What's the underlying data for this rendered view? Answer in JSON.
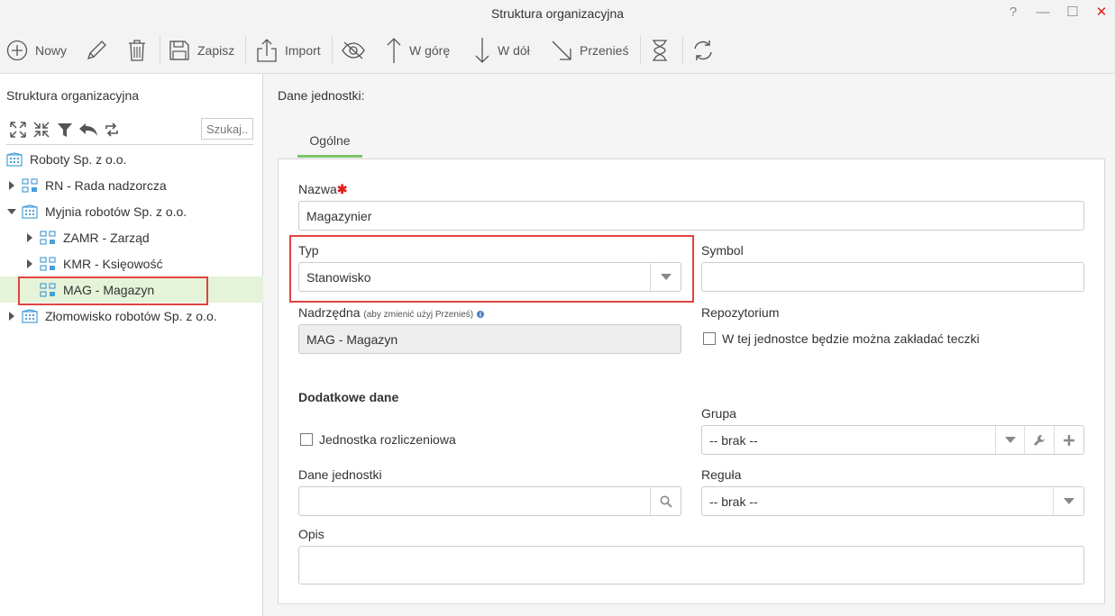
{
  "window": {
    "title": "Struktura organizacyjna",
    "help_glyph": "?",
    "min_glyph": "—",
    "max_glyph": "☐",
    "close_glyph": "✕"
  },
  "toolbar": {
    "new_label": "Nowy",
    "save_label": "Zapisz",
    "import_label": "Import",
    "up_label": "W górę",
    "down_label": "W dół",
    "move_label": "Przenieś"
  },
  "left_panel": {
    "title": "Struktura organizacyjna",
    "search_placeholder": "Szukaj...",
    "tree": [
      {
        "label": "Roboty Sp. z o.o.",
        "type": "company",
        "level": 0,
        "arrow": "none"
      },
      {
        "label": "RN - Rada nadzorcza",
        "type": "unit",
        "level": 0,
        "arrow": "collapsed"
      },
      {
        "label": "Myjnia robotów Sp. z o.o.",
        "type": "company",
        "level": 0,
        "arrow": "expanded"
      },
      {
        "label": "ZAMR - Zarząd",
        "type": "unit",
        "level": 1,
        "arrow": "collapsed"
      },
      {
        "label": "KMR - Księowość",
        "type": "unit",
        "level": 1,
        "arrow": "collapsed"
      },
      {
        "label": "MAG - Magazyn",
        "type": "unit",
        "level": 1,
        "arrow": "none",
        "selected": true
      },
      {
        "label": "Złomowisko robotów Sp. z o.o.",
        "type": "company",
        "level": 0,
        "arrow": "collapsed"
      }
    ]
  },
  "right_panel": {
    "section_title": "Dane jednostki:",
    "tab_general": "Ogólne",
    "name_label": "Nazwa",
    "required_mark": "✱",
    "name_value": "Magazynier",
    "type_label": "Typ",
    "type_value": "Stanowisko",
    "symbol_label": "Symbol",
    "symbol_value": "",
    "parent_label": "Nadrzędna",
    "parent_hint": "(aby zmienić użyj Przenieś)",
    "parent_value": "MAG - Magazyn",
    "repo_label": "Repozytorium",
    "repo_checkbox": "W tej jednostce będzie można zakładać teczki",
    "extra_title": "Dodatkowe dane",
    "billing_checkbox": "Jednostka rozliczeniowa",
    "group_label": "Grupa",
    "group_value": "-- brak --",
    "unit_data_label": "Dane jednostki",
    "unit_data_value": "",
    "rule_label": "Reguła",
    "rule_value": "-- brak --",
    "desc_label": "Opis",
    "desc_value": ""
  },
  "colors": {
    "accent_green": "#7cc36a",
    "selected_row": "#e5f3d8",
    "highlight_red": "#e0433f",
    "icon_blue": "#4a9fd8"
  }
}
